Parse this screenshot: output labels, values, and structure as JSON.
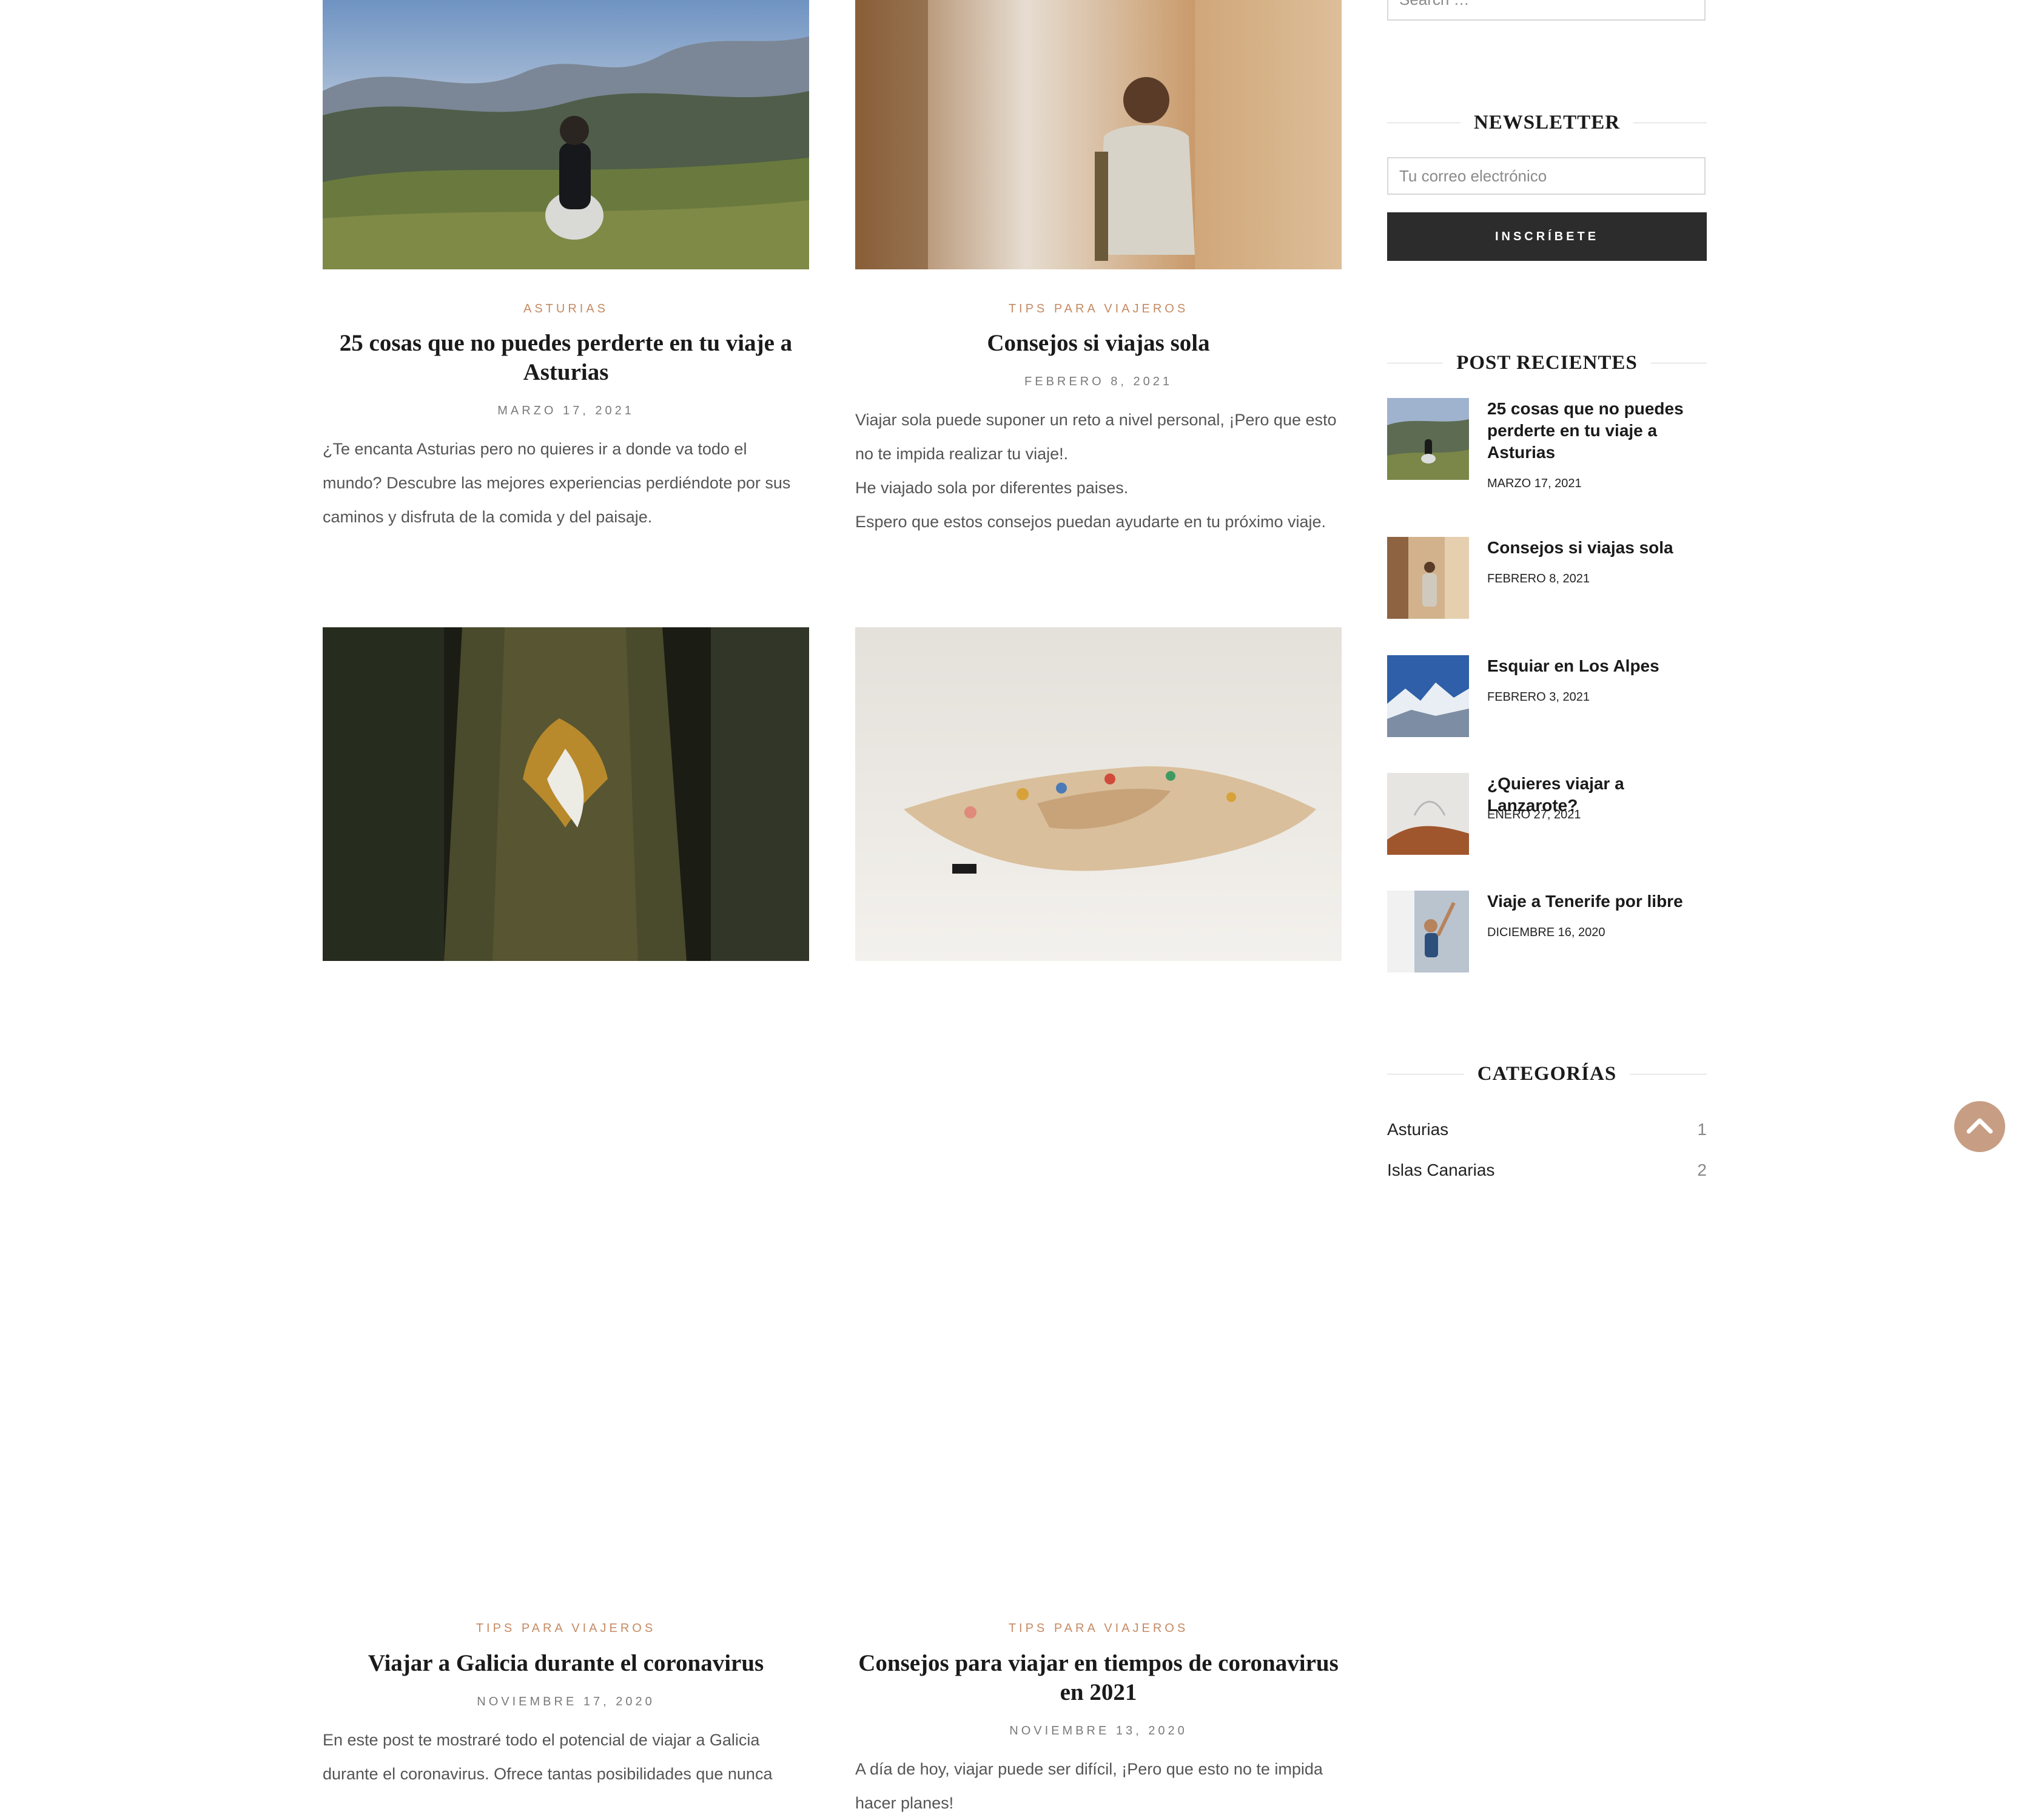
{
  "search": {
    "placeholder": "Search …"
  },
  "newsletter": {
    "title": "NEWSLETTER",
    "email_placeholder": "Tu correo electrónico",
    "button_label": "INSCRÍBETE"
  },
  "posts": [
    {
      "category": "ASTURIAS",
      "title": "25 cosas que no puedes perderte en tu viaje a Asturias",
      "date": "MARZO 17, 2021",
      "excerpt": [
        "¿Te encanta Asturias pero no quieres ir a donde va todo el mundo? Descubre las mejores experiencias perdiéndote por sus caminos y disfruta de la comida y del paisaje."
      ]
    },
    {
      "category": "TIPS PARA VIAJEROS",
      "title": "Consejos si viajas sola",
      "date": "FEBRERO 8, 2021",
      "excerpt": [
        "Viajar sola puede suponer un reto a nivel personal, ¡Pero que esto no te impida realizar tu viaje!.",
        "He viajado sola por diferentes paises.",
        "Espero que estos consejos puedan ayudarte en tu próximo viaje."
      ]
    },
    {
      "category": "TIPS PARA VIAJEROS",
      "title": "Viajar a Galicia durante el coronavirus",
      "date": "NOVIEMBRE 17, 2020",
      "excerpt": [
        "En este post te mostraré todo el potencial de viajar a Galicia durante el coronavirus. Ofrece tantas posibilidades que nunca"
      ]
    },
    {
      "category": "TIPS PARA VIAJEROS",
      "title": "Consejos para viajar en tiempos de coronavirus en 2021",
      "date": "NOVIEMBRE 13, 2020",
      "excerpt": [
        "A día de hoy, viajar puede ser difícil, ¡Pero que esto no te impida hacer planes!"
      ]
    }
  ],
  "recent_posts": {
    "title": "POST RECIENTES",
    "items": [
      {
        "title": "25 cosas que no puedes perderte en tu viaje a Asturias",
        "date": "MARZO 17, 2021"
      },
      {
        "title": "Consejos si viajas sola",
        "date": "FEBRERO 8, 2021"
      },
      {
        "title": "Esquiar en Los Alpes",
        "date": "FEBRERO 3, 2021"
      },
      {
        "title": "¿Quieres viajar a Lanzarote?",
        "date": "ENERO 27, 2021"
      },
      {
        "title": "Viaje a Tenerife por libre",
        "date": "DICIEMBRE 16, 2020"
      }
    ]
  },
  "categories": {
    "title": "CATEGORÍAS",
    "items": [
      {
        "name": "Asturias",
        "count": "1"
      },
      {
        "name": "Islas Canarias",
        "count": "2"
      }
    ]
  },
  "icons": {
    "back_to_top": "chevron-up-icon"
  },
  "colors": {
    "accent": "#c58a63",
    "button_dark": "#2c2c2c",
    "to_top": "#c79e84"
  }
}
